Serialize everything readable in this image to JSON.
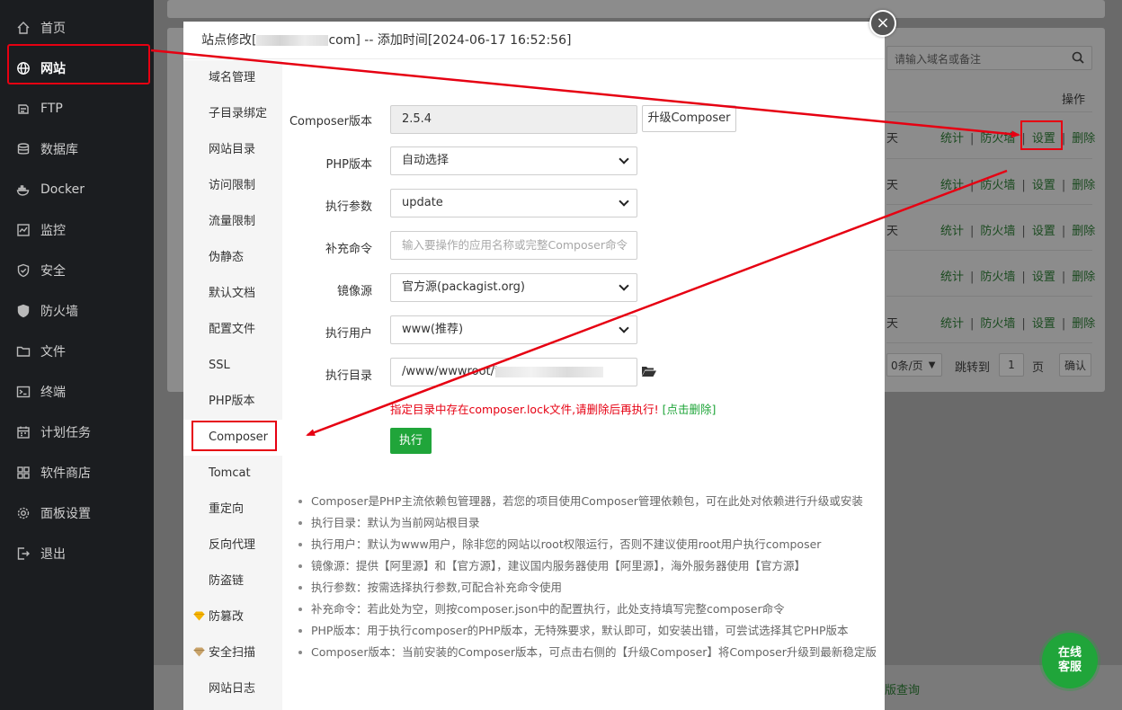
{
  "nav": {
    "items": [
      {
        "label": "首页",
        "icon": "home-icon"
      },
      {
        "label": "网站",
        "icon": "globe-icon"
      },
      {
        "label": "FTP",
        "icon": "ftp-icon"
      },
      {
        "label": "数据库",
        "icon": "database-icon"
      },
      {
        "label": "Docker",
        "icon": "docker-icon"
      },
      {
        "label": "监控",
        "icon": "monitor-icon"
      },
      {
        "label": "安全",
        "icon": "shield-icon"
      },
      {
        "label": "防火墙",
        "icon": "firewall-icon"
      },
      {
        "label": "文件",
        "icon": "folder-icon"
      },
      {
        "label": "终端",
        "icon": "terminal-icon"
      },
      {
        "label": "计划任务",
        "icon": "calendar-icon"
      },
      {
        "label": "软件商店",
        "icon": "apps-icon"
      },
      {
        "label": "面板设置",
        "icon": "gear-icon"
      },
      {
        "label": "退出",
        "icon": "logout-icon"
      }
    ],
    "active": "网站"
  },
  "background": {
    "search_placeholder": "请输入域名或备注",
    "ops_header": "操作",
    "rows": [
      {
        "expire": "天",
        "stats": "统计",
        "firewall": "防火墙",
        "settings": "设置",
        "delete": "删除"
      },
      {
        "expire": "天",
        "stats": "统计",
        "firewall": "防火墙",
        "settings": "设置",
        "delete": "删除"
      },
      {
        "expire": "天",
        "stats": "统计",
        "firewall": "防火墙",
        "settings": "设置",
        "delete": "删除"
      },
      {
        "expire": "",
        "stats": "统计",
        "firewall": "防火墙",
        "settings": "设置",
        "delete": "删除"
      },
      {
        "expire": "天",
        "stats": "统计",
        "firewall": "防火墙",
        "settings": "设置",
        "delete": "删除"
      }
    ],
    "pagination": {
      "per_page": "0条/页",
      "jump_label": "跳转到",
      "page_value": "1",
      "page_unit": "页",
      "confirm": "确认"
    },
    "footer_link": "版查询"
  },
  "modal": {
    "title_prefix": "站点修改[",
    "title_suffix": "com] -- 添加时间[2024-06-17 16:52:56]",
    "menu": [
      {
        "label": "域名管理"
      },
      {
        "label": "子目录绑定"
      },
      {
        "label": "网站目录"
      },
      {
        "label": "访问限制"
      },
      {
        "label": "流量限制"
      },
      {
        "label": "伪静态"
      },
      {
        "label": "默认文档"
      },
      {
        "label": "配置文件"
      },
      {
        "label": "SSL"
      },
      {
        "label": "PHP版本"
      },
      {
        "label": "Composer"
      },
      {
        "label": "Tomcat"
      },
      {
        "label": "重定向"
      },
      {
        "label": "反向代理"
      },
      {
        "label": "防盗链"
      },
      {
        "label": "防篡改"
      },
      {
        "label": "安全扫描"
      },
      {
        "label": "网站日志"
      }
    ],
    "active_menu": "Composer",
    "form": {
      "composer_version_label": "Composer版本",
      "composer_version_value": "2.5.4",
      "upgrade_button": "升级Composer",
      "php_version_label": "PHP版本",
      "php_version_value": "自动选择",
      "exec_args_label": "执行参数",
      "exec_args_value": "update",
      "extra_cmd_label": "补充命令",
      "extra_cmd_placeholder": "输入要操作的应用名称或完整Composer命令",
      "mirror_label": "镜像源",
      "mirror_value": "官方源(packagist.org)",
      "exec_user_label": "执行用户",
      "exec_user_value": "www(推荐)",
      "exec_dir_label": "执行目录",
      "exec_dir_value": "/www/wwwroot/te",
      "warning": "指定目录中存在composer.lock文件,请删除后再执行!",
      "warning_link": "[点击删除]",
      "run_button": "执行"
    },
    "tips": [
      "Composer是PHP主流依赖包管理器，若您的项目使用Composer管理依赖包，可在此处对依赖进行升级或安装",
      "执行目录：默认为当前网站根目录",
      "执行用户：默认为www用户，除非您的网站以root权限运行，否则不建议使用root用户执行composer",
      "镜像源：提供【阿里源】和【官方源】，建议国内服务器使用【阿里源】，海外服务器使用【官方源】",
      "执行参数：按需选择执行参数,可配合补充命令使用",
      "补充命令：若此处为空，则按composer.json中的配置执行，此处支持填写完整composer命令",
      "PHP版本：用于执行composer的PHP版本，无特殊要求，默认即可，如安装出错，可尝试选择其它PHP版本",
      "Composer版本：当前安装的Composer版本，可点击右侧的【升级Composer】将Composer升级到最新稳定版"
    ]
  },
  "close_symbol": "×",
  "online_service": {
    "line1": "在线",
    "line2": "客服"
  },
  "colors": {
    "accent_green": "#20a53a",
    "highlight_red": "#e60012",
    "nav_bg": "#1b1d20"
  }
}
